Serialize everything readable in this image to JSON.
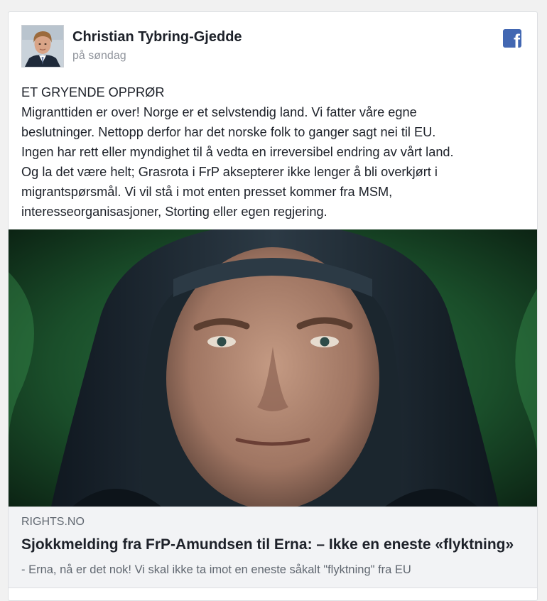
{
  "post": {
    "author_name": "Christian Tybring-Gjedde",
    "timestamp": "på søndag",
    "text_lines": [
      "ET GRYENDE OPPRØR",
      "Migranttiden er over! Norge er et selvstendig land. Vi fatter våre egne",
      "beslutninger. Nettopp derfor har det norske folk to ganger sagt nei til EU.",
      "Ingen har rett eller myndighet til å vedta en irreversibel endring av vårt land.",
      "Og la det være helt; Grasrota i FrP aksepterer ikke lenger å bli overkjørt i",
      "migrantspørsmål. Vi vil stå i mot enten presset kommer fra MSM,",
      "interesseorganisasjoner, Storting eller egen regjering."
    ]
  },
  "link": {
    "domain": "RIGHTS.NO",
    "title": "Sjokkmelding fra FrP-Amundsen til Erna: – Ikke en eneste «flyktning»",
    "description": "- Erna, nå er det nok! Vi skal ikke ta imot en eneste såkalt \"flyktning\" fra EU"
  },
  "icons": {
    "platform": "facebook-icon",
    "platform_glyph": "f"
  },
  "colors": {
    "facebook_blue": "#4267b2",
    "text_primary": "#1d2129",
    "text_secondary": "#90949c",
    "link_meta_bg": "#f2f3f5"
  }
}
